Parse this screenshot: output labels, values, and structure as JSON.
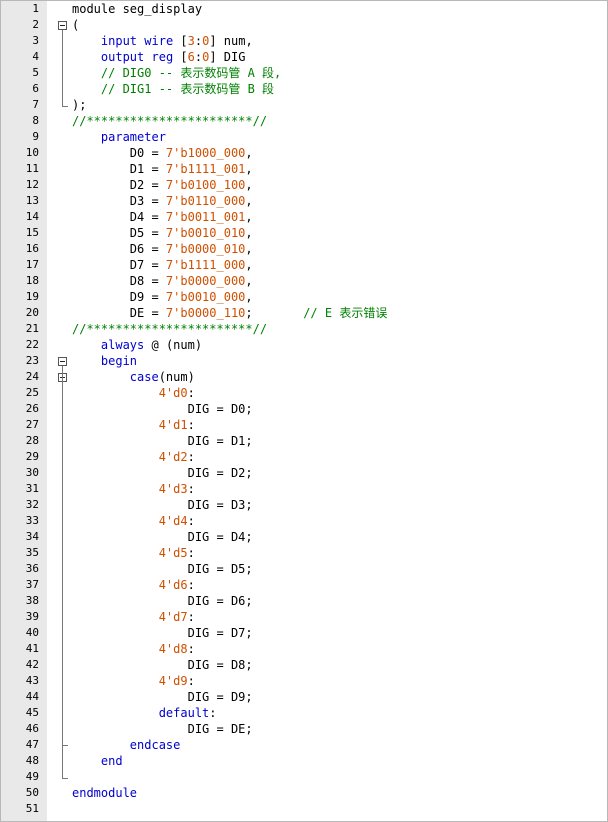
{
  "editor": {
    "lines": [
      [
        {
          "t": "module seg_display",
          "c": "tx"
        }
      ],
      [
        {
          "t": "(",
          "c": "tx"
        }
      ],
      [
        {
          "t": "    ",
          "c": "tx"
        },
        {
          "t": "input",
          "c": "kw"
        },
        {
          "t": " ",
          "c": "tx"
        },
        {
          "t": "wire",
          "c": "kw"
        },
        {
          "t": " [",
          "c": "tx"
        },
        {
          "t": "3",
          "c": "num"
        },
        {
          "t": ":",
          "c": "tx"
        },
        {
          "t": "0",
          "c": "num"
        },
        {
          "t": "] num,",
          "c": "tx"
        }
      ],
      [
        {
          "t": "    ",
          "c": "tx"
        },
        {
          "t": "output",
          "c": "kw"
        },
        {
          "t": " ",
          "c": "tx"
        },
        {
          "t": "reg",
          "c": "kw"
        },
        {
          "t": " [",
          "c": "tx"
        },
        {
          "t": "6",
          "c": "num"
        },
        {
          "t": ":",
          "c": "tx"
        },
        {
          "t": "0",
          "c": "num"
        },
        {
          "t": "] DIG",
          "c": "tx"
        }
      ],
      [
        {
          "t": "    ",
          "c": "tx"
        },
        {
          "t": "// DIG0 -- 表示数码管 A 段,",
          "c": "cm"
        }
      ],
      [
        {
          "t": "    ",
          "c": "tx"
        },
        {
          "t": "// DIG1 -- 表示数码管 B 段",
          "c": "cm"
        }
      ],
      [
        {
          "t": ");",
          "c": "tx"
        }
      ],
      [
        {
          "t": "//***********************//",
          "c": "cm"
        }
      ],
      [
        {
          "t": "    ",
          "c": "tx"
        },
        {
          "t": "parameter",
          "c": "kw"
        }
      ],
      [
        {
          "t": "        D0 = ",
          "c": "tx"
        },
        {
          "t": "7'b1000_000",
          "c": "num"
        },
        {
          "t": ",",
          "c": "tx"
        }
      ],
      [
        {
          "t": "        D1 = ",
          "c": "tx"
        },
        {
          "t": "7'b1111_001",
          "c": "num"
        },
        {
          "t": ",",
          "c": "tx"
        }
      ],
      [
        {
          "t": "        D2 = ",
          "c": "tx"
        },
        {
          "t": "7'b0100_100",
          "c": "num"
        },
        {
          "t": ",",
          "c": "tx"
        }
      ],
      [
        {
          "t": "        D3 = ",
          "c": "tx"
        },
        {
          "t": "7'b0110_000",
          "c": "num"
        },
        {
          "t": ",",
          "c": "tx"
        }
      ],
      [
        {
          "t": "        D4 = ",
          "c": "tx"
        },
        {
          "t": "7'b0011_001",
          "c": "num"
        },
        {
          "t": ",",
          "c": "tx"
        }
      ],
      [
        {
          "t": "        D5 = ",
          "c": "tx"
        },
        {
          "t": "7'b0010_010",
          "c": "num"
        },
        {
          "t": ",",
          "c": "tx"
        }
      ],
      [
        {
          "t": "        D6 = ",
          "c": "tx"
        },
        {
          "t": "7'b0000_010",
          "c": "num"
        },
        {
          "t": ",",
          "c": "tx"
        }
      ],
      [
        {
          "t": "        D7 = ",
          "c": "tx"
        },
        {
          "t": "7'b1111_000",
          "c": "num"
        },
        {
          "t": ",",
          "c": "tx"
        }
      ],
      [
        {
          "t": "        D8 = ",
          "c": "tx"
        },
        {
          "t": "7'b0000_000",
          "c": "num"
        },
        {
          "t": ",",
          "c": "tx"
        }
      ],
      [
        {
          "t": "        D9 = ",
          "c": "tx"
        },
        {
          "t": "7'b0010_000",
          "c": "num"
        },
        {
          "t": ",",
          "c": "tx"
        }
      ],
      [
        {
          "t": "        DE = ",
          "c": "tx"
        },
        {
          "t": "7'b0000_110",
          "c": "num"
        },
        {
          "t": ";       ",
          "c": "tx"
        },
        {
          "t": "// E 表示错误",
          "c": "cm"
        }
      ],
      [
        {
          "t": "//***********************//",
          "c": "cm"
        }
      ],
      [
        {
          "t": "    ",
          "c": "tx"
        },
        {
          "t": "always",
          "c": "kw"
        },
        {
          "t": " @ (num)",
          "c": "tx"
        }
      ],
      [
        {
          "t": "    ",
          "c": "tx"
        },
        {
          "t": "begin",
          "c": "kw"
        }
      ],
      [
        {
          "t": "        ",
          "c": "tx"
        },
        {
          "t": "case",
          "c": "kw"
        },
        {
          "t": "(num)",
          "c": "tx"
        }
      ],
      [
        {
          "t": "            ",
          "c": "tx"
        },
        {
          "t": "4'd0",
          "c": "num"
        },
        {
          "t": ":",
          "c": "tx"
        }
      ],
      [
        {
          "t": "                DIG = D0;",
          "c": "tx"
        }
      ],
      [
        {
          "t": "            ",
          "c": "tx"
        },
        {
          "t": "4'd1",
          "c": "num"
        },
        {
          "t": ":",
          "c": "tx"
        }
      ],
      [
        {
          "t": "                DIG = D1;",
          "c": "tx"
        }
      ],
      [
        {
          "t": "            ",
          "c": "tx"
        },
        {
          "t": "4'd2",
          "c": "num"
        },
        {
          "t": ":",
          "c": "tx"
        }
      ],
      [
        {
          "t": "                DIG = D2;",
          "c": "tx"
        }
      ],
      [
        {
          "t": "            ",
          "c": "tx"
        },
        {
          "t": "4'd3",
          "c": "num"
        },
        {
          "t": ":",
          "c": "tx"
        }
      ],
      [
        {
          "t": "                DIG = D3;",
          "c": "tx"
        }
      ],
      [
        {
          "t": "            ",
          "c": "tx"
        },
        {
          "t": "4'd4",
          "c": "num"
        },
        {
          "t": ":",
          "c": "tx"
        }
      ],
      [
        {
          "t": "                DIG = D4;",
          "c": "tx"
        }
      ],
      [
        {
          "t": "            ",
          "c": "tx"
        },
        {
          "t": "4'd5",
          "c": "num"
        },
        {
          "t": ":",
          "c": "tx"
        }
      ],
      [
        {
          "t": "                DIG = D5;",
          "c": "tx"
        }
      ],
      [
        {
          "t": "            ",
          "c": "tx"
        },
        {
          "t": "4'd6",
          "c": "num"
        },
        {
          "t": ":",
          "c": "tx"
        }
      ],
      [
        {
          "t": "                DIG = D6;",
          "c": "tx"
        }
      ],
      [
        {
          "t": "            ",
          "c": "tx"
        },
        {
          "t": "4'd7",
          "c": "num"
        },
        {
          "t": ":",
          "c": "tx"
        }
      ],
      [
        {
          "t": "                DIG = D7;",
          "c": "tx"
        }
      ],
      [
        {
          "t": "            ",
          "c": "tx"
        },
        {
          "t": "4'd8",
          "c": "num"
        },
        {
          "t": ":",
          "c": "tx"
        }
      ],
      [
        {
          "t": "                DIG = D8;",
          "c": "tx"
        }
      ],
      [
        {
          "t": "            ",
          "c": "tx"
        },
        {
          "t": "4'd9",
          "c": "num"
        },
        {
          "t": ":",
          "c": "tx"
        }
      ],
      [
        {
          "t": "                DIG = D9;",
          "c": "tx"
        }
      ],
      [
        {
          "t": "            ",
          "c": "tx"
        },
        {
          "t": "default",
          "c": "kw"
        },
        {
          "t": ":",
          "c": "tx"
        }
      ],
      [
        {
          "t": "                DIG = DE;",
          "c": "tx"
        }
      ],
      [
        {
          "t": "        ",
          "c": "tx"
        },
        {
          "t": "endcase",
          "c": "kw"
        }
      ],
      [
        {
          "t": "    ",
          "c": "tx"
        },
        {
          "t": "end",
          "c": "kw"
        }
      ],
      [],
      [
        {
          "t": "endmodule",
          "c": "kw"
        }
      ],
      []
    ],
    "fold_markers": [
      {
        "type": "box",
        "line": 2
      },
      {
        "type": "span",
        "from": 2,
        "to": 7
      },
      {
        "type": "box",
        "line": 23
      },
      {
        "type": "box",
        "line": 24
      },
      {
        "type": "span",
        "from": 23,
        "to": 49
      },
      {
        "type": "end",
        "line": 47
      }
    ],
    "colors": {
      "keyword": "#0000d0",
      "number": "#d05000",
      "comment": "#008000",
      "text": "#000000",
      "gutter": "#e9e9e9"
    }
  }
}
